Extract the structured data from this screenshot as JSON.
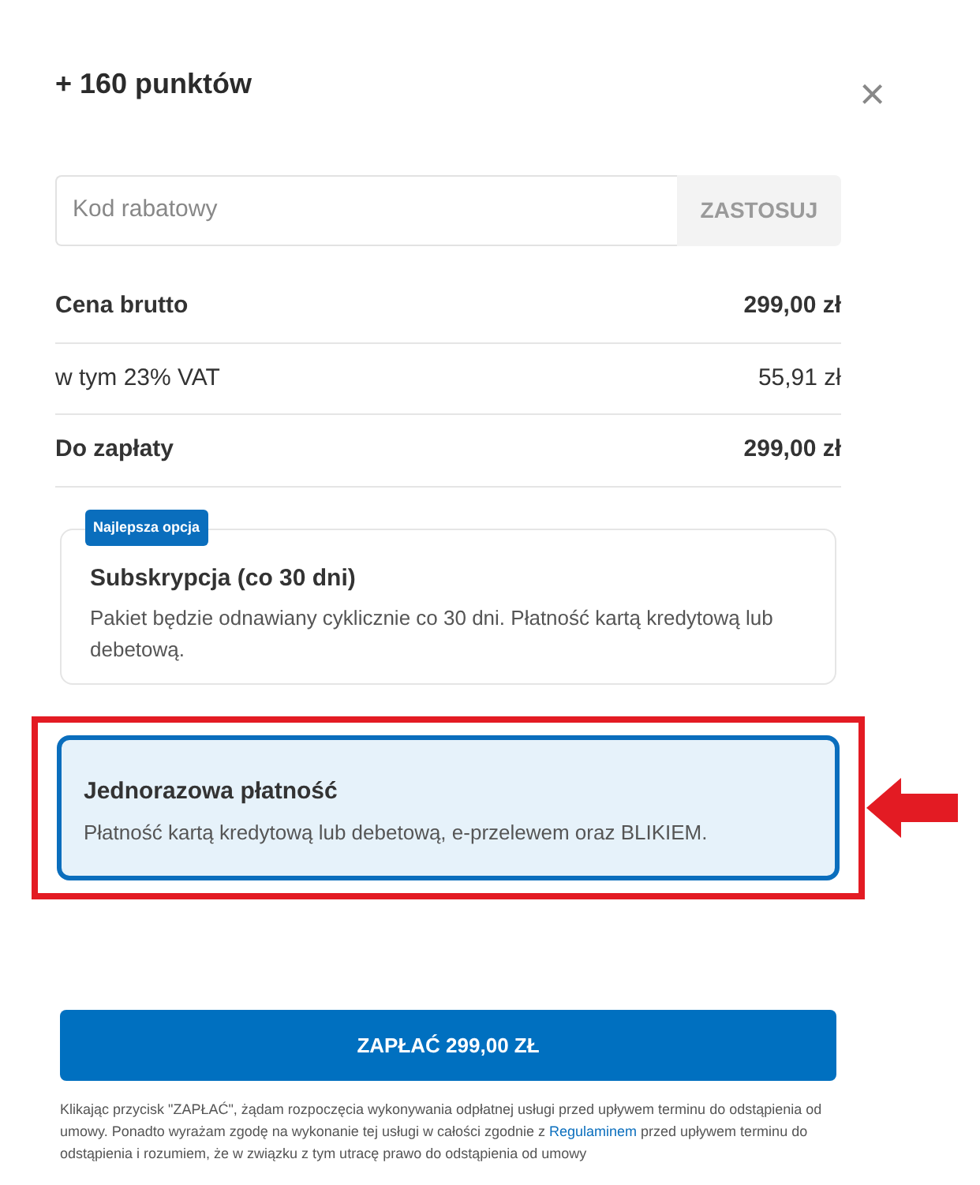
{
  "title": "+ 160 punktów",
  "close": "×",
  "discount": {
    "placeholder": "Kod rabatowy",
    "button": "ZASTOSUJ"
  },
  "summary": [
    {
      "label": "Cena brutto",
      "value": "299,00 zł",
      "bold": true
    },
    {
      "label": "w tym 23% VAT",
      "value": "55,91 zł",
      "bold": false
    },
    {
      "label": "Do zapłaty",
      "value": "299,00 zł",
      "bold": true
    }
  ],
  "options": [
    {
      "badge": "Najlepsza opcja",
      "title": "Subskrypcja (co 30 dni)",
      "description": "Pakiet będzie odnawiany cyklicznie co 30 dni. Płatność kartą kredytową lub debetową.",
      "selected": false,
      "highlighted": false
    },
    {
      "title": "Jednorazowa płatność",
      "description": "Płatność kartą kredytową lub debetową, e-przelewem oraz BLIKIEM.",
      "selected": true,
      "highlighted": true
    }
  ],
  "pay_button": "ZAPŁAĆ 299,00 ZŁ",
  "legal": {
    "before": "Klikając przycisk \"ZAPŁAĆ\", żądam rozpoczęcia wykonywania odpłatnej usługi przed upływem terminu do odstąpienia od umowy. Ponadto wyrażam zgodę na wykonanie tej usługi w całości zgodnie z ",
    "link": "Regulaminem",
    "after": " przed upływem terminu do odstąpienia i rozumiem, że w związku z tym utracę prawo do odstąpienia od umowy"
  }
}
